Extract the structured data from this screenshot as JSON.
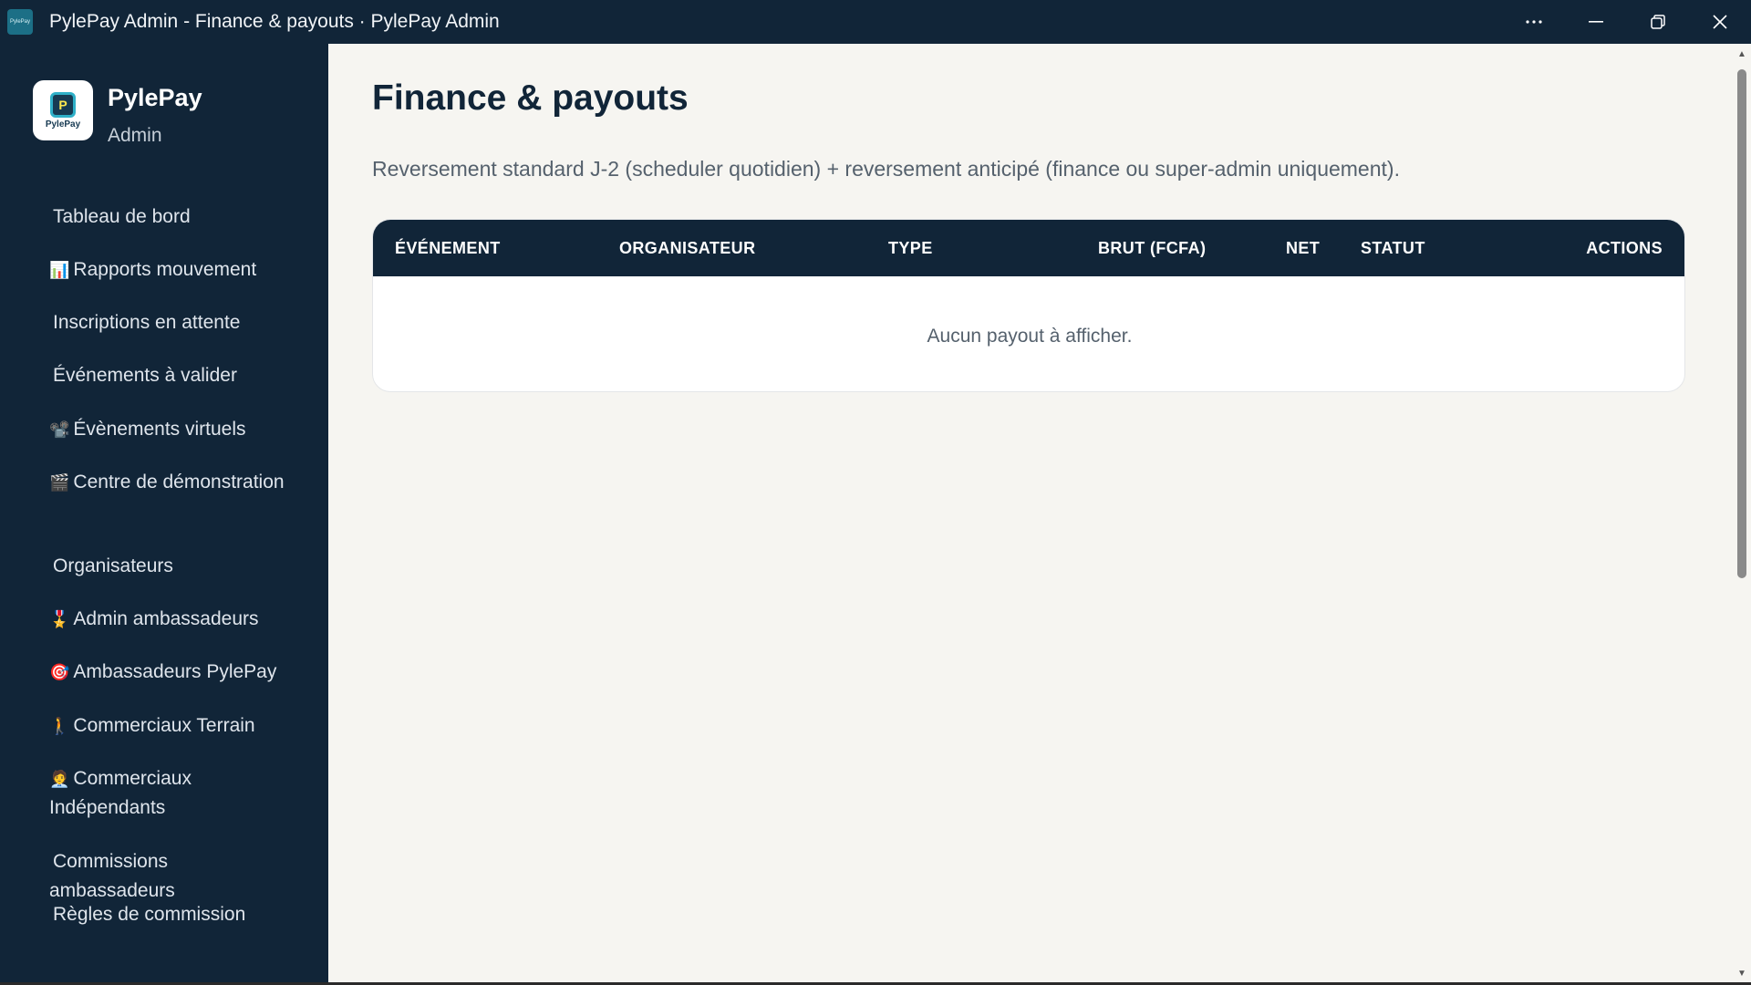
{
  "window": {
    "title": "PylePay Admin - Finance & payouts · PylePay Admin",
    "icon_text": "PylePay"
  },
  "brand": {
    "name": "PylePay",
    "subtitle": "Admin",
    "logo_text": "PylePay",
    "logo_mark": "P"
  },
  "sidebar": {
    "items": [
      {
        "emoji": "",
        "label": "Tableau de bord"
      },
      {
        "emoji": "📊",
        "label": "Rapports mouvement"
      },
      {
        "emoji": "",
        "label": "Inscriptions en attente"
      },
      {
        "emoji": "",
        "label": "Événements à valider"
      },
      {
        "emoji": "📽️",
        "label": "Évènements virtuels"
      },
      {
        "emoji": "🎬",
        "label": "Centre de démonstration"
      },
      {
        "emoji": "",
        "label": "Organisateurs"
      },
      {
        "emoji": "🎖️",
        "label": "Admin ambassadeurs"
      },
      {
        "emoji": "🎯",
        "label": "Ambassadeurs PylePay"
      },
      {
        "emoji": "🚶",
        "label": "Commerciaux Terrain"
      },
      {
        "emoji": "🧑‍💼",
        "label": "Commerciaux Indépendants"
      },
      {
        "emoji": "",
        "label": "Commissions ambassadeurs"
      },
      {
        "emoji": "",
        "label": "Règles de commission"
      }
    ]
  },
  "main": {
    "title": "Finance & payouts",
    "subtitle": "Reversement standard J-2 (scheduler quotidien) + reversement anticipé (finance ou super-admin uniquement).",
    "table": {
      "columns": [
        "ÉVÉNEMENT",
        "ORGANISATEUR",
        "TYPE",
        "BRUT (FCFA)",
        "NET",
        "STATUT",
        "ACTIONS"
      ],
      "empty_message": "Aucun payout à afficher."
    }
  },
  "colors": {
    "sidebar_bg": "#112538",
    "content_bg": "#f6f5f1",
    "title_color": "#112538"
  }
}
